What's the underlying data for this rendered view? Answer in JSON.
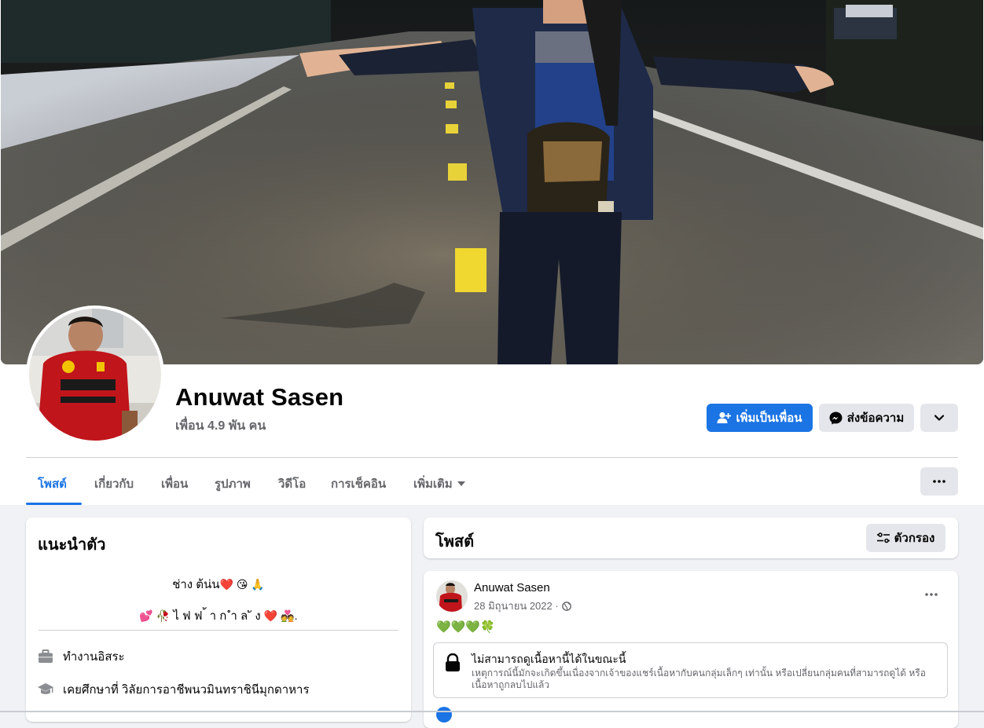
{
  "profile": {
    "name": "Anuwat Sasen",
    "friends_count": "เพื่อน 4.9 พัน คน"
  },
  "actions": {
    "add_friend": "เพิ่มเป็นเพื่อน",
    "message": "ส่งข้อความ"
  },
  "tabs": [
    {
      "label": "โพสต์",
      "active": true
    },
    {
      "label": "เกี่ยวกับ"
    },
    {
      "label": "เพื่อน"
    },
    {
      "label": "รูปภาพ"
    },
    {
      "label": "วิดีโอ"
    },
    {
      "label": "การเช็คอิน"
    },
    {
      "label": "เพิ่มเติม"
    }
  ],
  "intro": {
    "title": "แนะนำตัว",
    "bio_line1": "ช่าง ต้น่น",
    "bio_line1_emoji": "❤️ 😘 🙏",
    "bio_line2_emoji_pre": "💕 🥀",
    "bio_line2": "ไ ฟ ฟ ้ า ก ำ ล ั ง",
    "bio_line2_emoji_post": "❤️ 💑.",
    "work": "ทำงานอิสระ",
    "education": "เคยศึกษาที่ วิลัยการอาชีพนวมินทราชินีมุกดาหาร"
  },
  "posts_section": {
    "title": "โพสต์",
    "filter_label": "ตัวกรอง"
  },
  "post": {
    "author": "Anuwat Sasen",
    "date": "28 มิถุนายน 2022 ·",
    "text": "💚💚💚🍀",
    "unavailable_title": "ไม่สามารถดูเนื้อหานี้ได้ในขณะนี้",
    "unavailable_desc": "เหตุการณ์นี้มักจะเกิดขึ้นเนื่องจากเจ้าของแชร์เนื้อหากับคนกลุ่มเล็กๆ เท่านั้น หรือเปลี่ยนกลุ่มคนที่สามารถดูได้ หรือเนื้อหาถูกลบไปแล้ว"
  },
  "colors": {
    "accent": "#1b74e4",
    "secondary_button": "#e4e6eb",
    "background": "#f0f2f5",
    "muted_text": "#65676b"
  },
  "icons": [
    "add-friend-icon",
    "messenger-icon",
    "chevron-down-icon",
    "more-icon",
    "filter-icon",
    "briefcase-icon",
    "graduation-cap-icon",
    "globe-icon",
    "lock-icon"
  ]
}
